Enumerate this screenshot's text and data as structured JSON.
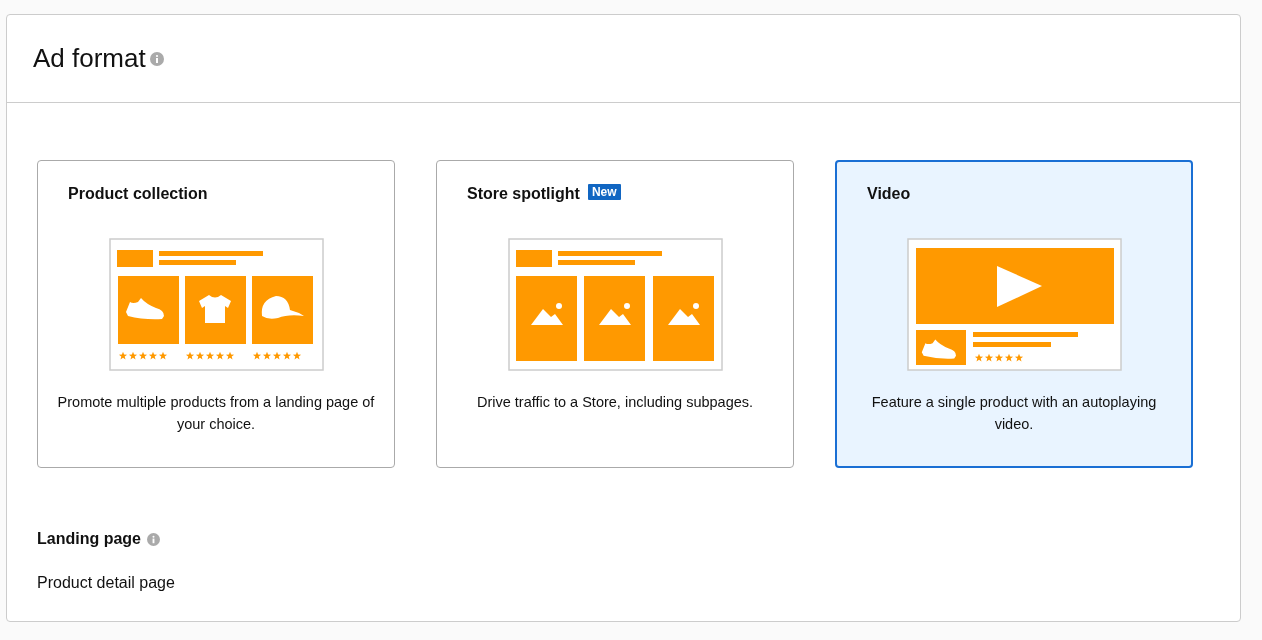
{
  "panel": {
    "title": "Ad format"
  },
  "formats": [
    {
      "kind": "collection",
      "title": "Product collection",
      "description": "Promote multiple products from a landing page of your choice.",
      "selected": false
    },
    {
      "kind": "spotlight",
      "title": "Store spotlight",
      "badge": "New",
      "description": "Drive traffic to a Store, including subpages.",
      "selected": false
    },
    {
      "kind": "video",
      "title": "Video",
      "description": "Feature a single product with an autoplaying video.",
      "selected": true
    }
  ],
  "landing_page": {
    "label": "Landing page",
    "value": "Product detail page"
  }
}
